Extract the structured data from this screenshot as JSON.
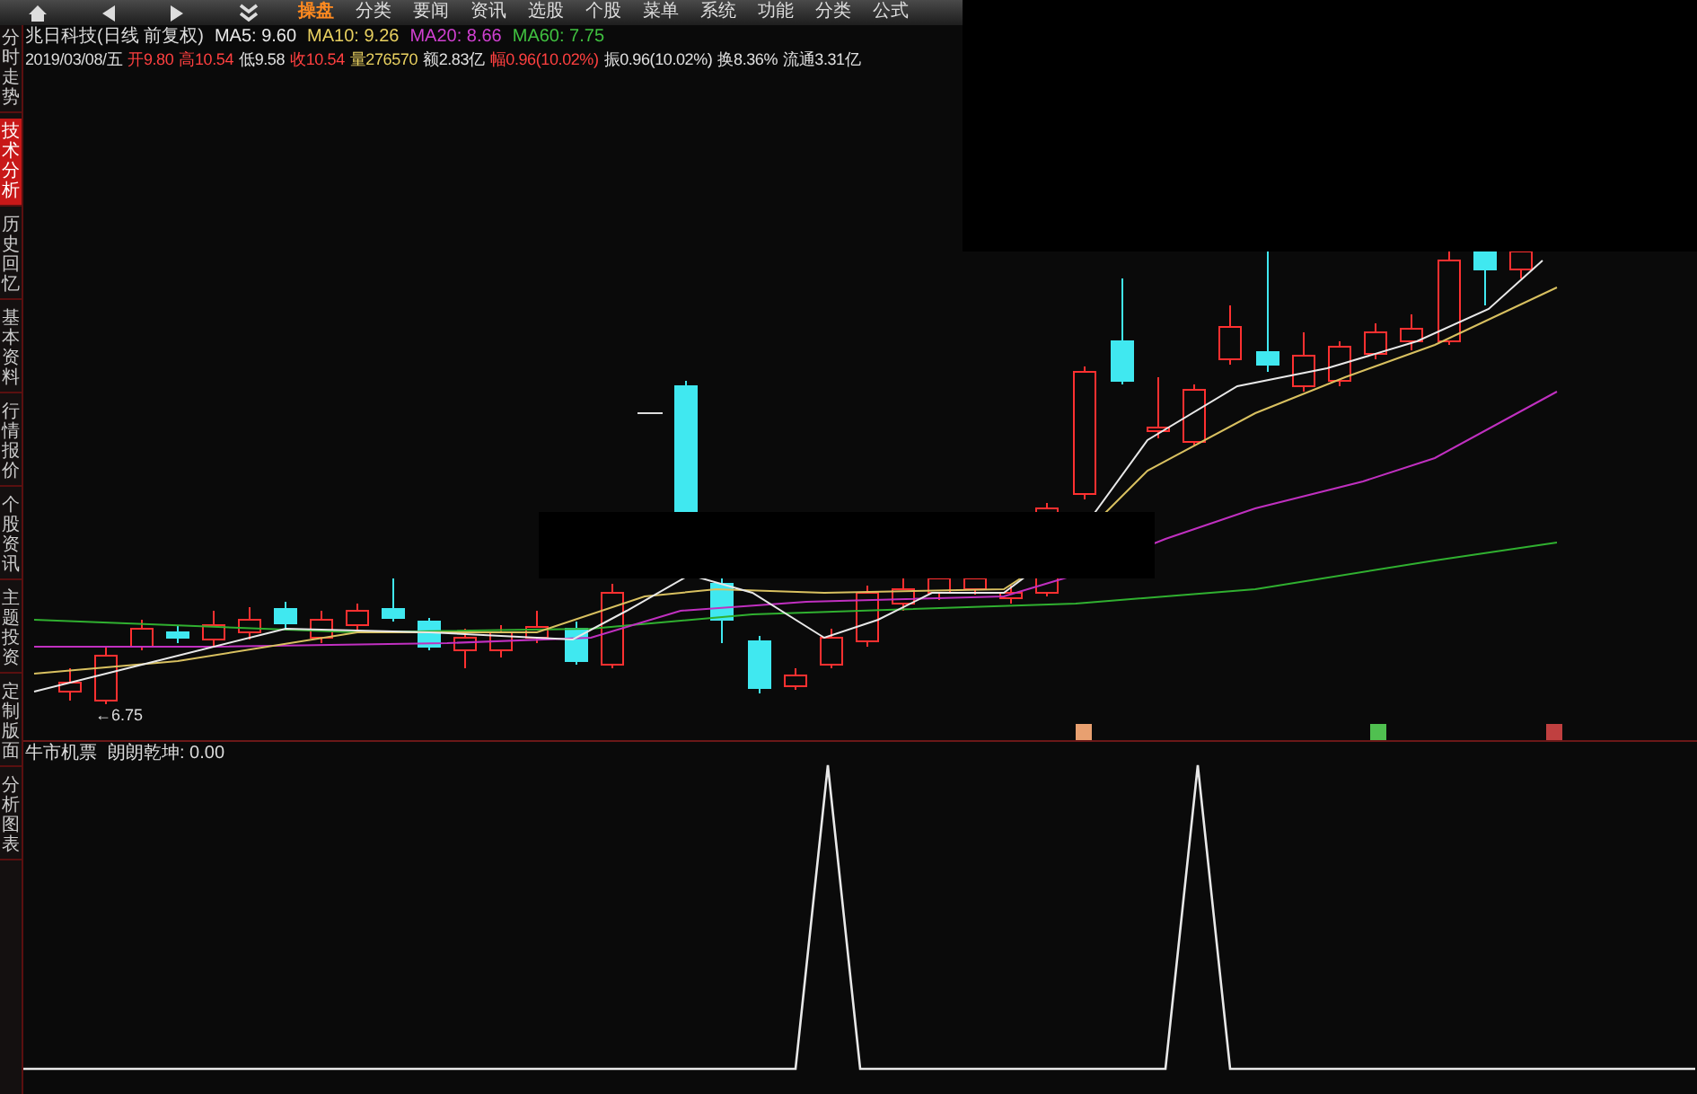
{
  "toolbar": {
    "menu": [
      {
        "label": "操盘",
        "selected": true
      },
      {
        "label": "分类",
        "selected": false
      },
      {
        "label": "要闻",
        "selected": false
      },
      {
        "label": "资讯",
        "selected": false
      },
      {
        "label": "选股",
        "selected": false
      },
      {
        "label": "个股",
        "selected": false
      },
      {
        "label": "菜单",
        "selected": false
      },
      {
        "label": "系统",
        "selected": false
      },
      {
        "label": "功能",
        "selected": false
      },
      {
        "label": "分类",
        "selected": false
      },
      {
        "label": "公式",
        "selected": false
      }
    ]
  },
  "sidebar": {
    "tabs": [
      {
        "label": "分时走势",
        "selected": false
      },
      {
        "label": "技术分析",
        "selected": true
      },
      {
        "label": "历史回忆",
        "selected": false
      },
      {
        "label": "基本资料",
        "selected": false
      },
      {
        "label": "行情报价",
        "selected": false
      },
      {
        "label": "个股资讯",
        "selected": false
      },
      {
        "label": "主题投资",
        "selected": false
      },
      {
        "label": "定制版面",
        "selected": false
      },
      {
        "label": "分析图表",
        "selected": false
      }
    ]
  },
  "header": {
    "title": "兆日科技(日线 前复权)",
    "ma": [
      {
        "label": "MA5: 9.60",
        "color": "#e8e8e8"
      },
      {
        "label": "MA10: 9.26",
        "color": "#e8d060"
      },
      {
        "label": "MA20: 8.66",
        "color": "#d040d0"
      },
      {
        "label": "MA60: 7.75",
        "color": "#40c040"
      }
    ]
  },
  "quote": {
    "date": "2019/03/08/五",
    "fields": [
      {
        "label": "开",
        "value": "9.80",
        "color": "#ff4040"
      },
      {
        "label": "高",
        "value": "10.54",
        "color": "#ff4040"
      },
      {
        "label": "低",
        "value": "9.58",
        "color": "#e0e0e0"
      },
      {
        "label": "收",
        "value": "10.54",
        "color": "#ff4040"
      },
      {
        "label": "量",
        "value": "276570",
        "color": "#e8d060"
      },
      {
        "label": "额",
        "value": "2.83亿",
        "color": "#e0e0e0"
      },
      {
        "label": "幅",
        "value": "0.96(10.02%)",
        "color": "#ff4040"
      },
      {
        "label": "振",
        "value": "0.96(10.02%)",
        "color": "#e0e0e0"
      },
      {
        "label": "换",
        "value": "8.36%",
        "color": "#e0e0e0"
      },
      {
        "label": "流通",
        "value": "3.31亿",
        "color": "#e0e0e0"
      }
    ]
  },
  "price_chart": {
    "low_marker": "←6.75",
    "signals": [
      {
        "color": "#e8a070"
      },
      {
        "color": "#50c050"
      },
      {
        "color": "#c04040"
      }
    ]
  },
  "indicator": {
    "name": "牛市机票",
    "line": "朗朗乾坤: 0.00"
  }
}
